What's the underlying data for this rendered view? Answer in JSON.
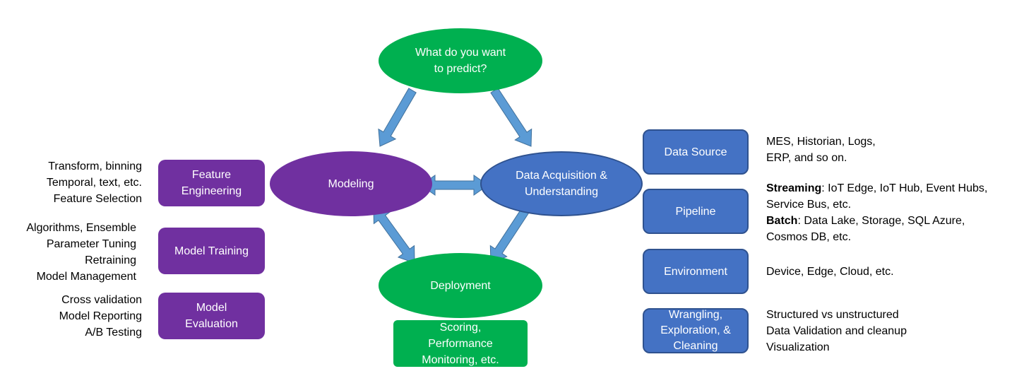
{
  "colors": {
    "green": "#00B050",
    "purple": "#7030A0",
    "blue": "#4472C4",
    "arrow": "#5B9BD5"
  },
  "nodes": {
    "predict": "What do you want to predict?",
    "modeling": "Modeling",
    "data_acq": "Data Acquisition & Understanding",
    "deployment": "Deployment",
    "scoring": "Scoring, Performance Monitoring, etc."
  },
  "left": [
    {
      "label": "Feature Engineering",
      "details": [
        "Transform, binning",
        "Temporal, text, etc.",
        "Feature Selection"
      ]
    },
    {
      "label": "Model Training",
      "details": [
        "Algorithms, Ensemble",
        "Parameter Tuning",
        "Retraining",
        "Model Management"
      ]
    },
    {
      "label": "Model Evaluation",
      "details": [
        "Cross validation",
        "Model Reporting",
        "A/B Testing"
      ]
    }
  ],
  "right": [
    {
      "label": "Data Source",
      "details": [
        "MES, Historian, Logs,",
        "ERP, and so on."
      ]
    },
    {
      "label": "Pipeline",
      "streaming_bold": "Streaming",
      "streaming_text": ": IoT Edge, IoT Hub, Event Hubs,",
      "streaming_text2": "Service Bus, etc.",
      "batch_bold": "Batch",
      "batch_text": ": Data Lake, Storage, SQL Azure,",
      "batch_text2": "Cosmos DB, etc."
    },
    {
      "label": "Environment",
      "details": [
        "Device, Edge, Cloud, etc."
      ]
    },
    {
      "label": "Wrangling, Exploration, & Cleaning",
      "details": [
        "Structured vs unstructured",
        "Data Validation and cleanup",
        "Visualization"
      ]
    }
  ]
}
